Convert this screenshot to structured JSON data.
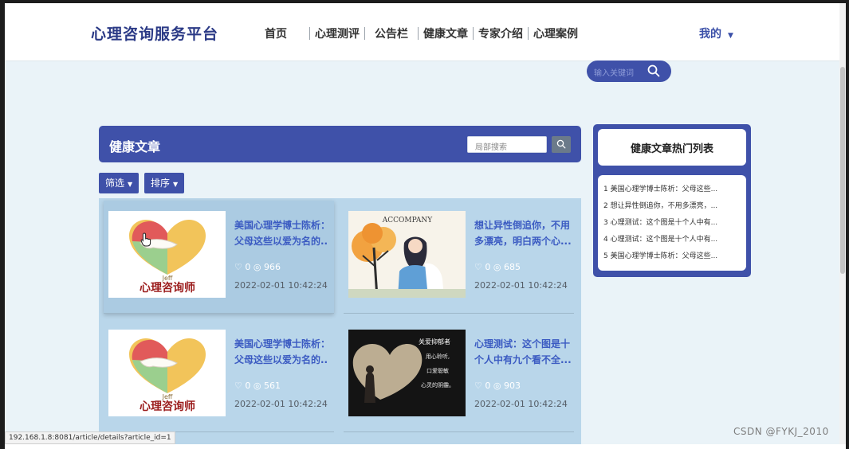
{
  "header": {
    "brand": "心理咨询服务平台",
    "nav": [
      "首页",
      "心理测评",
      "公告栏",
      "健康文章",
      "专家介绍",
      "心理案例"
    ],
    "my_menu": "我的"
  },
  "search": {
    "placeholder": "输入关键词"
  },
  "section": {
    "title": "健康文章",
    "local_search_placeholder": "局部搜索",
    "filter_label": "筛选",
    "sort_label": "排序"
  },
  "articles": [
    {
      "title": "美国心理学博士陈析：父母这些以爱为名的..",
      "likes": "0",
      "views": "966",
      "date": "2022-02-01 10:42:24",
      "image": "heart-hands-logo",
      "thumb_text": "心理咨询师",
      "thumb_sub": "Jeff"
    },
    {
      "title": "想让异性倒追你，不用多漂亮，明白两个心...",
      "likes": "0",
      "views": "685",
      "date": "2022-02-01 10:42:24",
      "image": "accompany-illustration",
      "thumb_text": "ACCOMPANY"
    },
    {
      "title": "美国心理学博士陈析：父母这些以爱为名的..",
      "likes": "0",
      "views": "561",
      "date": "2022-02-01 10:42:24",
      "image": "heart-hands-logo",
      "thumb_text": "心理咨询师",
      "thumb_sub": "Jeff"
    },
    {
      "title": "心理测试：这个图是十个人中有九个看不全...",
      "likes": "0",
      "views": "903",
      "date": "2022-02-01 10:42:24",
      "image": "dark-heart-photo",
      "thumb_lines": [
        "关爱抑郁者",
        "用心聆听,",
        "口爱聪敏",
        "心灵的阴霾。"
      ]
    }
  ],
  "hot": {
    "title": "健康文章热门列表",
    "items": [
      "1 美国心理学博士陈析：父母这些...",
      "2 想让异性倒追你，不用多漂亮，...",
      "3 心理测试：这个图是十个人中有...",
      "4 心理测试：这个图是十个人中有...",
      "5 美国心理学博士陈析：父母这些..."
    ]
  },
  "status_url": "192.168.1.8:8081/article/details?article_id=1",
  "watermark": "CSDN @FYKJ_2010",
  "colors": {
    "primary": "#3f51a9",
    "link": "#3b5bc2",
    "list_bg": "#b9d6ea",
    "page_bg": "#eaf3f8"
  },
  "icons": {
    "search": "search-icon",
    "like": "like-icon",
    "view": "eye-icon",
    "caret": "caret-down-icon",
    "cursor": "hand-pointer-icon"
  }
}
